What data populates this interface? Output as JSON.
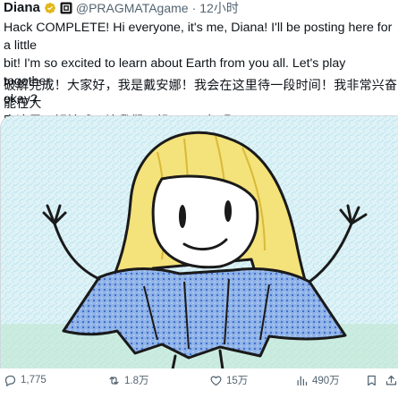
{
  "post": {
    "author": {
      "display_name": "Diana",
      "handle": "@PRAGMATAgame",
      "verified": true
    },
    "separator": "·",
    "timestamp": "12小时",
    "text_en": "Hack COMPLETE! Hi everyone, it's me, Diana! I'll be posting here for a little\nbit! I'm so excited to learn about Earth from you all. Let's play together,\nokay?",
    "text_zh": "破解完成！大家好，我是戴安娜！我会在这里待一段时间！我非常兴奋能在大\n家这里了解地球。让我们一起玩吧，好吗？",
    "media": {
      "icon": "drawing-image",
      "colors": {
        "background": "#dff3f7",
        "hair": "#f4e27a",
        "dress": "#8fb3e8",
        "outline": "#1a1a1a"
      }
    }
  },
  "actions": {
    "reply": {
      "icon": "reply-icon",
      "count": "1,775"
    },
    "repost": {
      "icon": "repost-icon",
      "count": "1.8万"
    },
    "like": {
      "icon": "heart-icon",
      "count": "15万"
    },
    "views": {
      "icon": "views-icon",
      "count": "490万"
    },
    "bookmark": {
      "icon": "bookmark-icon"
    },
    "share": {
      "icon": "share-icon"
    }
  },
  "colors": {
    "text": "#0f1419",
    "secondary_text": "#536471",
    "verified_gold": "#e2b719",
    "border": "#cfd9de"
  }
}
